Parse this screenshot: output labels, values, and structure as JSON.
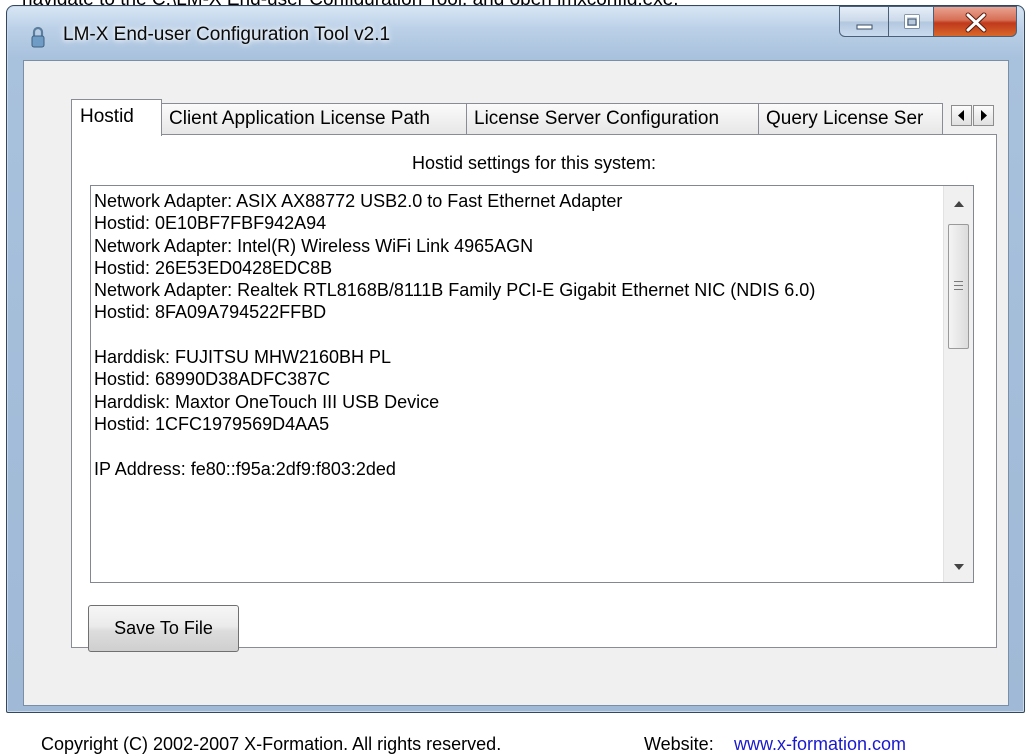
{
  "cut_text": "navigate to the C:\\LM-X End-user Configuration Tool, and open lmxconfig.exe.",
  "window": {
    "title": "LM-X End-user Configuration Tool v2.1",
    "icons": {
      "app": "lock-icon",
      "minimize": "minimize-icon",
      "maximize": "maximize-icon",
      "close": "close-icon"
    }
  },
  "tabs": [
    {
      "label": "Hostid",
      "active": true
    },
    {
      "label": "Client Application License Path",
      "active": false
    },
    {
      "label": "License Server Configuration",
      "active": false
    },
    {
      "label": "Query License Ser",
      "active": false
    }
  ],
  "hostid_panel": {
    "heading": "Hostid settings for this system:",
    "lines": [
      "Network Adapter: ASIX AX88772 USB2.0 to Fast Ethernet Adapter",
      "Hostid: 0E10BF7FBF942A94",
      "Network Adapter: Intel(R) Wireless WiFi Link 4965AGN",
      "Hostid: 26E53ED0428EDC8B",
      "Network Adapter: Realtek RTL8168B/8111B Family PCI-E Gigabit Ethernet NIC (NDIS 6.0)",
      "Hostid: 8FA09A794522FFBD",
      "",
      "Harddisk: FUJITSU MHW2160BH PL",
      "Hostid: 68990D38ADFC387C",
      "Harddisk: Maxtor OneTouch III USB Device",
      "Hostid: 1CFC1979569D4AA5",
      "",
      "IP Address: fe80::f95a:2df9:f803:2ded"
    ],
    "save_button": "Save To File"
  },
  "footer": {
    "copyright": "Copyright (C) 2002-2007 X-Formation. All rights reserved.",
    "website_label": "Website:",
    "website_link": "www.x-formation.com"
  },
  "colors": {
    "link": "#1a1acc",
    "close_button": "#c0391c",
    "frame": "#a8c1dd"
  }
}
